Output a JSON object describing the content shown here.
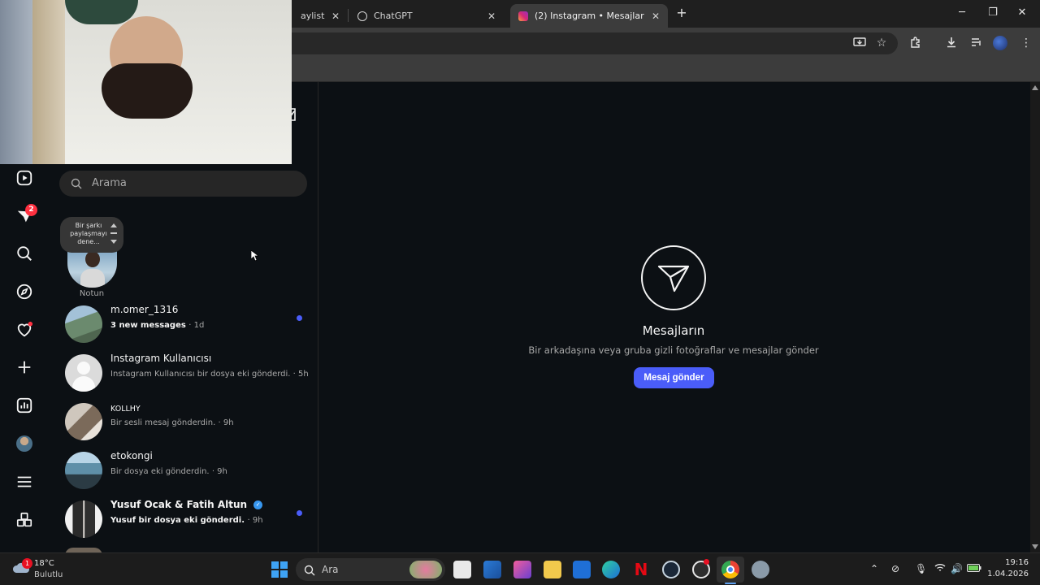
{
  "browser": {
    "tabs": [
      {
        "title": "aylist",
        "active": false
      },
      {
        "title": "ChatGPT",
        "active": false
      },
      {
        "title": "(2) Instagram • Mesajlar",
        "active": true
      }
    ],
    "new_tab_label": "+",
    "window": {
      "minimize": "─",
      "restore": "❐",
      "close": "✕"
    }
  },
  "nav": {
    "notifications_badge": "2"
  },
  "inbox": {
    "search_placeholder": "Arama",
    "note": {
      "bubble_text": "Bir şarkı paylaşmayı dene...",
      "label": "Notun"
    },
    "conversations": [
      {
        "name": "m.omer_1316",
        "preview": "3 new messages",
        "time": "· 1d",
        "unread": true,
        "avatar_color": "#6b8a6e"
      },
      {
        "name": "Instagram Kullanıcısı",
        "preview": "Instagram Kullanıcısı bir dosya eki gönderdi.",
        "time": "· 5h",
        "unread": false,
        "avatar_color": "#dbdbdb"
      },
      {
        "name": "KOLLHY",
        "preview": "Bir sesli mesaj gönderdin.",
        "time": "· 9h",
        "unread": false,
        "avatar_color": "#8a7a6a"
      },
      {
        "name": "etokongi",
        "preview": "Bir dosya eki gönderdin.",
        "time": "· 9h",
        "unread": false,
        "avatar_color": "#5f8fa8"
      },
      {
        "name": "Yusuf Ocak & Fatih Altun",
        "preview": "Yusuf bir dosya eki gönderdi.",
        "time": "· 9h",
        "unread": true,
        "avatar_color": "#3a3a3a"
      }
    ]
  },
  "empty_state": {
    "title": "Mesajların",
    "subtitle": "Bir arkadaşına veya gruba gizli fotoğraflar ve mesajlar gönder",
    "button": "Mesaj gönder"
  },
  "taskbar": {
    "weather_temp": "18°C",
    "weather_desc": "Bulutlu",
    "weather_badge": "1",
    "search_placeholder": "Ara",
    "time": "19:16",
    "date": "1.04.2026"
  }
}
